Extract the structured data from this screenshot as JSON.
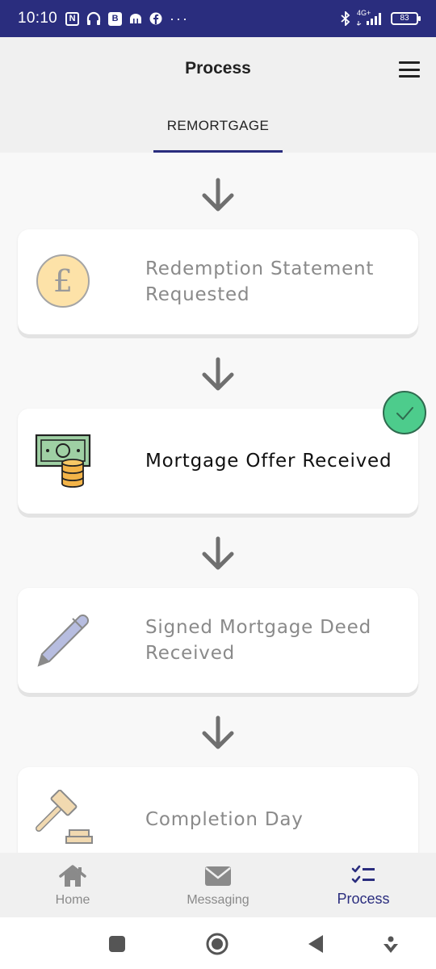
{
  "status_bar": {
    "time": "10:10",
    "battery": "83",
    "network": "4G+",
    "icons": [
      "nfc-icon",
      "headphones-icon",
      "b-app-icon",
      "kakao-icon",
      "facebook-icon",
      "more-dots-icon",
      "bluetooth-icon",
      "signal-icon",
      "battery-icon"
    ]
  },
  "header": {
    "title": "Process",
    "tab_label": "REMORTGAGE"
  },
  "steps": [
    {
      "label": "Redemption Statement Requested",
      "icon": "pound-coin-icon",
      "active": false
    },
    {
      "label": "Mortgage Offer Received",
      "icon": "money-stack-icon",
      "active": true
    },
    {
      "label": "Signed Mortgage Deed Received",
      "icon": "pen-icon",
      "active": false
    },
    {
      "label": "Completion Day",
      "icon": "gavel-icon",
      "active": false
    }
  ],
  "bottom_nav": {
    "items": [
      {
        "label": "Home",
        "icon": "home-icon"
      },
      {
        "label": "Messaging",
        "icon": "envelope-icon"
      },
      {
        "label": "Process",
        "icon": "checklist-icon"
      }
    ],
    "selected": "Process"
  },
  "colors": {
    "primary": "#2a2d7e",
    "success": "#4dcc8c",
    "arrow": "#6f6f6f",
    "inactive_text": "#8a8a8a"
  }
}
